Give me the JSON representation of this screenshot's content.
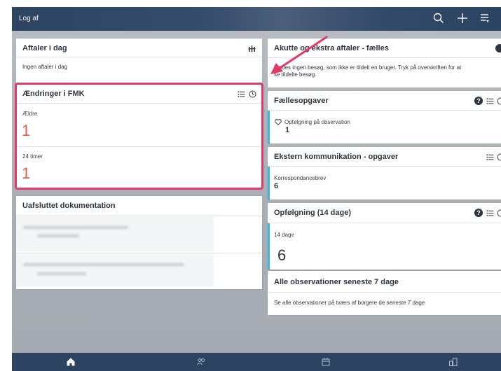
{
  "topbar": {
    "logout_label": "Log af"
  },
  "icons": {
    "search": "search-icon",
    "add": "plus-icon",
    "menu": "list-filter-icon",
    "home": "home-icon",
    "citizens": "people-icon",
    "calendar": "calendar-icon",
    "buildings": "buildings-icon"
  },
  "colors": {
    "topbar": "#2d4462",
    "highlight": "#e23a62",
    "accent": "#3fb8e0",
    "red_number": "#e25b4b",
    "arrow": "#e23a62"
  },
  "left": {
    "aftaler": {
      "title": "Aftaler i dag",
      "empty": "Ingen aftaler i dag"
    },
    "fmk": {
      "title": "Ændringer i FMK",
      "rows": [
        {
          "label": "Ældre",
          "value": "1"
        },
        {
          "label": "24 timer",
          "value": "1"
        }
      ]
    },
    "uafsluttet": {
      "title": "Uafsluttet dokumentation"
    }
  },
  "right": {
    "akutte": {
      "title": "Akutte og ekstra aftaler - fælles",
      "text_line1": "Findes ingen besøg, som ikke er tildelt en bruger. Tryk på overskriften for at",
      "text_line2": "se tildelte besøg."
    },
    "faelles": {
      "title": "Fællesopgaver",
      "item_label": "Opfølgning på observation",
      "item_value": "1"
    },
    "ekstern": {
      "title": "Ekstern kommunikation - opgaver",
      "item_label": "Korrespondancebrev",
      "item_value": "6"
    },
    "opfolgning": {
      "title": "Opfølgning (14 dage)",
      "item_label": "14 dage",
      "item_value": "6"
    },
    "observationer": {
      "title": "Alle observationer seneste 7 dage",
      "text": "Se alle observationer på tværs af borgere de seneste 7 dage"
    }
  }
}
